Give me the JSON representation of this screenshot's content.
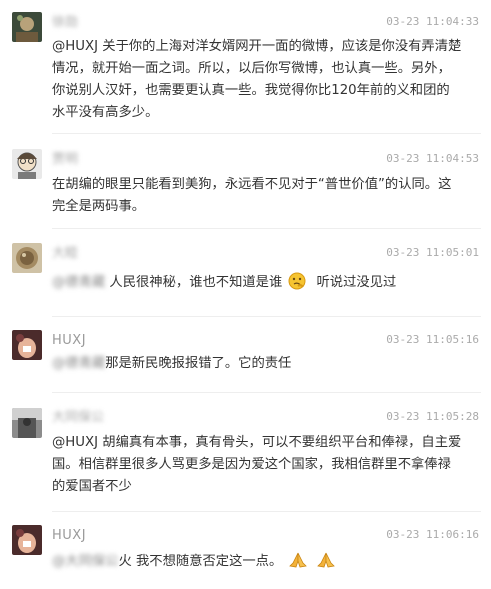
{
  "comments": [
    {
      "name": "徐勋",
      "time": "03-23 11:04:33",
      "text": "@HUXJ 关于你的上海对洋女婿网开一面的微博，应该是你没有弄清楚情况，就开始一面之词。所以，以后你写微博，也认真一些。另外，你说别人汉奸，也需要更认真一些。我觉得你比120年前的义和团的水平没有高多少。"
    },
    {
      "name": "贾明",
      "time": "03-23 11:04:53",
      "text": "在胡编的眼里只能看到美狗，永远看不见对于“普世价值”的认同。这完全是两码事。"
    },
    {
      "name": "大睦",
      "time": "03-23 11:05:01",
      "mention": "@德青藏",
      "text": " 人民很神秘，谁也不知道是谁",
      "text_after": " 听说过没见过",
      "emoji": "thinking-face-icon"
    },
    {
      "name": "HUXJ",
      "time": "03-23 11:05:16",
      "mention": "@德青藏",
      "text": "那是新民晚报报错了。它的责任"
    },
    {
      "name": "大同保公",
      "time": "03-23 11:05:28",
      "text": "@HUXJ 胡编真有本事，真有骨头，可以不要组织平台和俸禄，自主爱国。相信群里很多人骂更多是因为爱这个国家，我相信群里不拿俸禄的爱国者不少"
    },
    {
      "name": "HUXJ",
      "time": "03-23 11:06:16",
      "mention": "@大同保公",
      "text": "火 我不想随意否定这一点。",
      "emoji": "praying-hands-icon"
    }
  ]
}
